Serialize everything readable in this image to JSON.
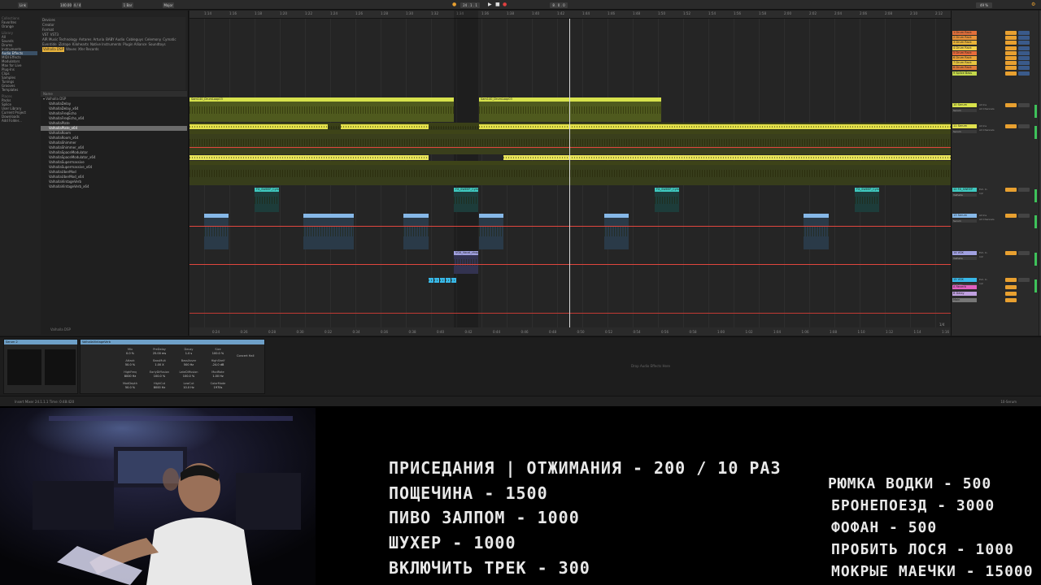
{
  "transport": {
    "link": "Link",
    "tempo": "140.00",
    "time_sig": "4 / 4",
    "bar": "1 Bar",
    "key": "Major",
    "position": "24 . 1 . 1",
    "loop_len": "8 . 0 . 0",
    "cpu": "49 %",
    "zoom": "1/4"
  },
  "browser": {
    "categories": [
      {
        "label": "Collections",
        "head": true
      },
      {
        "label": "Favorites"
      },
      {
        "label": "Orange"
      },
      {
        "label": "Library",
        "head": true
      },
      {
        "label": "All"
      },
      {
        "label": "Sounds"
      },
      {
        "label": "Drums"
      },
      {
        "label": "Instruments"
      },
      {
        "label": "Audio Effects",
        "selected": true
      },
      {
        "label": "MIDI Effects"
      },
      {
        "label": "Modulators"
      },
      {
        "label": "Max for Live"
      },
      {
        "label": "Plug-Ins"
      },
      {
        "label": "Clips"
      },
      {
        "label": "Samples"
      },
      {
        "label": "Tunings"
      },
      {
        "label": "Grooves"
      },
      {
        "label": "Templates"
      },
      {
        "label": "Places",
        "head": true
      },
      {
        "label": "Packs"
      },
      {
        "label": "Splice"
      },
      {
        "label": "User Library"
      },
      {
        "label": "Current Project"
      },
      {
        "label": "Downloads"
      },
      {
        "label": "Add Folder..."
      }
    ],
    "filters": {
      "devices_label": "Devices",
      "creator_label": "Creator",
      "format_label": "Format",
      "formats": [
        "VST",
        "VST3"
      ],
      "vendors": [
        "AIR Music Technology",
        "Antares",
        "Arturia",
        "BABY Audio",
        "Cableguys",
        "Celemony",
        "Cymatic",
        "Eventide",
        "iZotope",
        "Kilohearts",
        "Native Instruments",
        "Plugin Alliance",
        "Soundtoys",
        "Valhalla DSP",
        "Waves",
        "Xfer Records"
      ],
      "selected_vendor": "Valhalla DSP"
    },
    "file_header": "Name",
    "folder": "Valhalla DSP",
    "files": [
      "ValhallaDelay",
      "ValhallaDelay_x64",
      "ValhallaFreqEcho",
      "ValhallaFreqEcho_x64",
      "ValhallaPlate",
      "ValhallaPlate_x64",
      "ValhallaRoom",
      "ValhallaRoom_x64",
      "ValhallaShimmer",
      "ValhallaShimmer_x64",
      "ValhallaSpaceModulator",
      "ValhallaSpaceModulator_x64",
      "ValhallaSupermassive",
      "ValhallaSupermassive_x64",
      "ValhallaUberMod",
      "ValhallaUberMod_x64",
      "ValhallaVintageVerb",
      "ValhallaVintageVerb_x64"
    ],
    "selected_file_index": 5,
    "bottom_text": "Valhalla DSP"
  },
  "arrangement": {
    "ticks": [
      "1:14",
      "1:16",
      "1:18",
      "1:20",
      "1:22",
      "1:24",
      "1:26",
      "1:28",
      "1:30",
      "1:32",
      "1:34",
      "1:36",
      "1:38",
      "1:40",
      "1:42",
      "1:44",
      "1:46",
      "1:48",
      "1:50",
      "1:52",
      "1:54",
      "1:56",
      "1:58",
      "2:00",
      "2:02",
      "2:04",
      "2:06",
      "2:08",
      "2:10",
      "2:12"
    ],
    "bottom_ticks": [
      "0:24",
      "0:26",
      "0:28",
      "0:30",
      "0:32",
      "0:34",
      "0:36",
      "0:38",
      "0:40",
      "0:42",
      "0:44",
      "0:46",
      "0:48",
      "0:50",
      "0:52",
      "0:54",
      "0:56",
      "0:58",
      "1:00",
      "1:02",
      "1:04",
      "1:06",
      "1:08",
      "1:10",
      "1:12",
      "1:14",
      "1:16"
    ],
    "clip_names": {
      "drum": "Sam140_DrumLoop03",
      "fx": "FX_SWEEP_Cym",
      "vox": "VOX_Vocal_chop"
    }
  },
  "mixer": {
    "tracks": [
      {
        "name": "1 Drum Rack",
        "color": "#e26f3a"
      },
      {
        "name": "2 Drum Rack",
        "color": "#e89238"
      },
      {
        "name": "3 Drum Rack",
        "color": "#e8b238"
      },
      {
        "name": "4 Drum Rack",
        "color": "#f0d04a"
      },
      {
        "name": "5 Drum Rack",
        "color": "#e86a3a"
      },
      {
        "name": "6 Drum Rack",
        "color": "#e8a238"
      },
      {
        "name": "7 Drum Rack",
        "color": "#e8c540"
      },
      {
        "name": "8 Drum Rack",
        "color": "#e07a3a"
      },
      {
        "name": "9 Splice Bass",
        "color": "#c4d84a"
      }
    ],
    "groups": [
      {
        "name": "10 Serum",
        "sub": "Serum",
        "color": "#d8e24a",
        "io": "All Ins",
        "io2": "All Channels"
      },
      {
        "name": "11 Serum",
        "sub": "Serum",
        "color": "#e0e04e",
        "io": "All Ins",
        "io2": "All Channels"
      },
      {
        "name": "12 FX_SWEEP",
        "sub": "Valhalla",
        "color": "#3fc9c0",
        "io": "Ext. In",
        "io2": "1/2"
      },
      {
        "name": "13 Serum",
        "sub": "Serum",
        "color": "#86b8e8",
        "io": "All Ins",
        "io2": "All Channels"
      },
      {
        "name": "14 VOX",
        "sub": "Valhalla",
        "color": "#a0a0e0",
        "io": "Ext. In",
        "io2": "1/2"
      },
      {
        "name": "15 VOX",
        "sub": "Valhalla",
        "color": "#38b8e8",
        "io": "Ext. In",
        "io2": "1/2"
      }
    ],
    "returns": [
      {
        "name": "A Reverb",
        "color": "#e060c0"
      },
      {
        "name": "B Delay",
        "color": "#c0a0e0"
      },
      {
        "name": "Main",
        "color": "#777777"
      }
    ],
    "master_label": "Main"
  },
  "devices": {
    "device1_name": "Serum 2",
    "device2_name": "ValhallaVintageVerb",
    "params": [
      {
        "name": "Mix",
        "value": "0.0 %"
      },
      {
        "name": "PreDelay",
        "value": "25.00 ms"
      },
      {
        "name": "Decay",
        "value": "1.0 s"
      },
      {
        "name": "Size",
        "value": "100.0 %"
      },
      {
        "name": "Attack",
        "value": "50.0 %"
      },
      {
        "name": "BassMult",
        "value": "1.00 X"
      },
      {
        "name": "BassXover",
        "value": "500 Hz"
      },
      {
        "name": "HighShelf",
        "value": "-24.0 dB"
      },
      {
        "name": "HighFreq",
        "value": "8000 Hz"
      },
      {
        "name": "EarlyDiffusion",
        "value": "100.0 %"
      },
      {
        "name": "LateDiffusion",
        "value": "100.0 %"
      },
      {
        "name": "ModRate",
        "value": "1.00 Hz"
      },
      {
        "name": "ModDepth",
        "value": "50.0 %"
      },
      {
        "name": "HighCut",
        "value": "8000 Hz"
      },
      {
        "name": "LowCut",
        "value": "10.0 Hz"
      },
      {
        "name": "ColorMode",
        "value": "1970s"
      }
    ],
    "preset": "Concert Hall",
    "drop_text": "Drop Audio Effects Here"
  },
  "statusbar": {
    "text": "Insert Mixer 24.1.1.1 Time: 0:48:420",
    "right": "10-Serum"
  },
  "stream": {
    "left_lines": [
      "ПРИСЕДАНИЯ | ОТЖИМАНИЯ - 200 / 10 РАЗ",
      "ПОЩЕЧИНА - 1500",
      "ПИВО ЗАЛПОМ - 1000",
      "ШУХЕР - 1000",
      "ВКЛЮЧИТЬ ТРЕК - 300"
    ],
    "right_lines": [
      "РЮМКА ВОДКИ - 500",
      "БРОНЕПОЕЗД - 3000",
      "ФОФАН - 500",
      "ПРОБИТЬ ЛОСЯ - 1000",
      "МОКРЫЕ МАЕЧКИ - 15000"
    ]
  }
}
